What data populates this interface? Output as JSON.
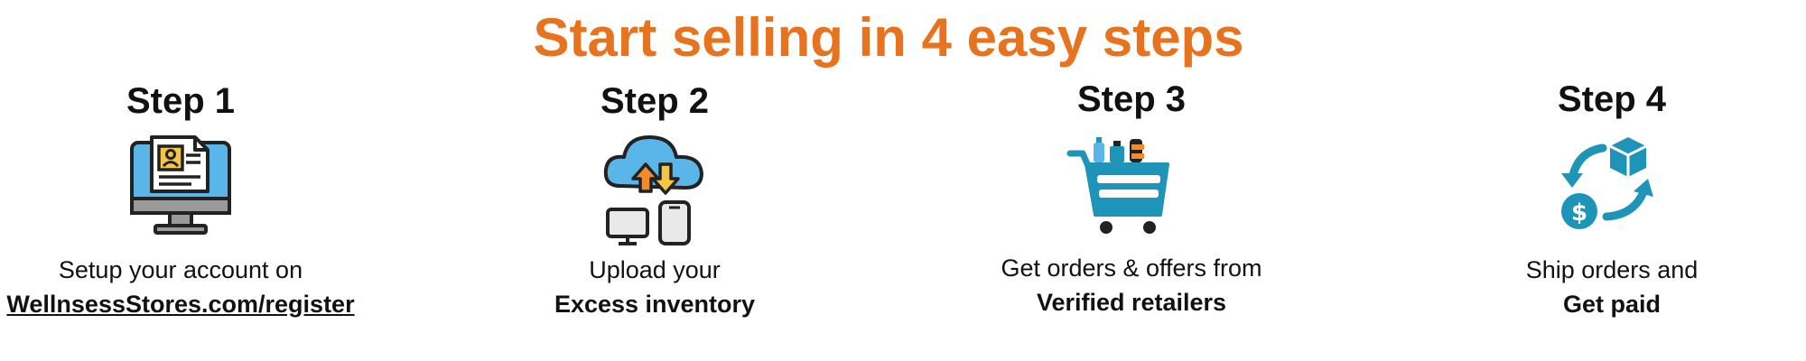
{
  "title": "Start selling in 4 easy steps",
  "colors": {
    "title": "#E8731F",
    "text": "#111111",
    "accent_blue": "#1E95B8",
    "light_blue": "#5AB5E8",
    "orange": "#F28C28",
    "yellow": "#F5C544",
    "gray": "#9A9A9A",
    "dark": "#222222"
  },
  "steps": [
    {
      "heading": "Step 1",
      "icon": "registration-computer-icon",
      "line1": "Setup your account on",
      "line2": "WellnsessStores.com/register"
    },
    {
      "heading": "Step 2",
      "icon": "cloud-upload-devices-icon",
      "line1": "Upload your",
      "line2": "Excess inventory"
    },
    {
      "heading": "Step 3",
      "icon": "shopping-cart-products-icon",
      "line1": "Get orders & offers from",
      "line2": "Verified retailers"
    },
    {
      "heading": "Step 4",
      "icon": "ship-and-get-paid-icon",
      "line1": "Ship orders and",
      "line2": "Get paid"
    }
  ]
}
